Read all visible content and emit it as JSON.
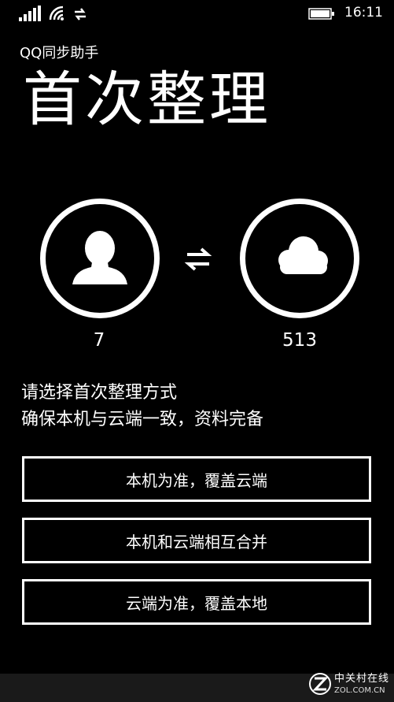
{
  "status_bar": {
    "time": "16:11",
    "icons": [
      "signal-strength-icon",
      "wifi-icon",
      "data-sync-icon",
      "battery-icon"
    ]
  },
  "header": {
    "app_name": "QQ同步助手",
    "title": "首次整理"
  },
  "sync_graphic": {
    "local": {
      "icon": "person-icon",
      "count": "7"
    },
    "swap_icon": "swap-arrows-icon",
    "cloud": {
      "icon": "cloud-icon",
      "count": "513"
    }
  },
  "instructions": {
    "line1": "请选择首次整理方式",
    "line2": "确保本机与云端一致，资料完备"
  },
  "options": [
    {
      "label": "本机为准，覆盖云端"
    },
    {
      "label": "本机和云端相互合并"
    },
    {
      "label": "云端为准，覆盖本地"
    }
  ],
  "watermark": {
    "text_cn": "中关村在线",
    "text_en": "ZOL.COM.CN"
  },
  "colors": {
    "background": "#000000",
    "foreground": "#ffffff"
  }
}
